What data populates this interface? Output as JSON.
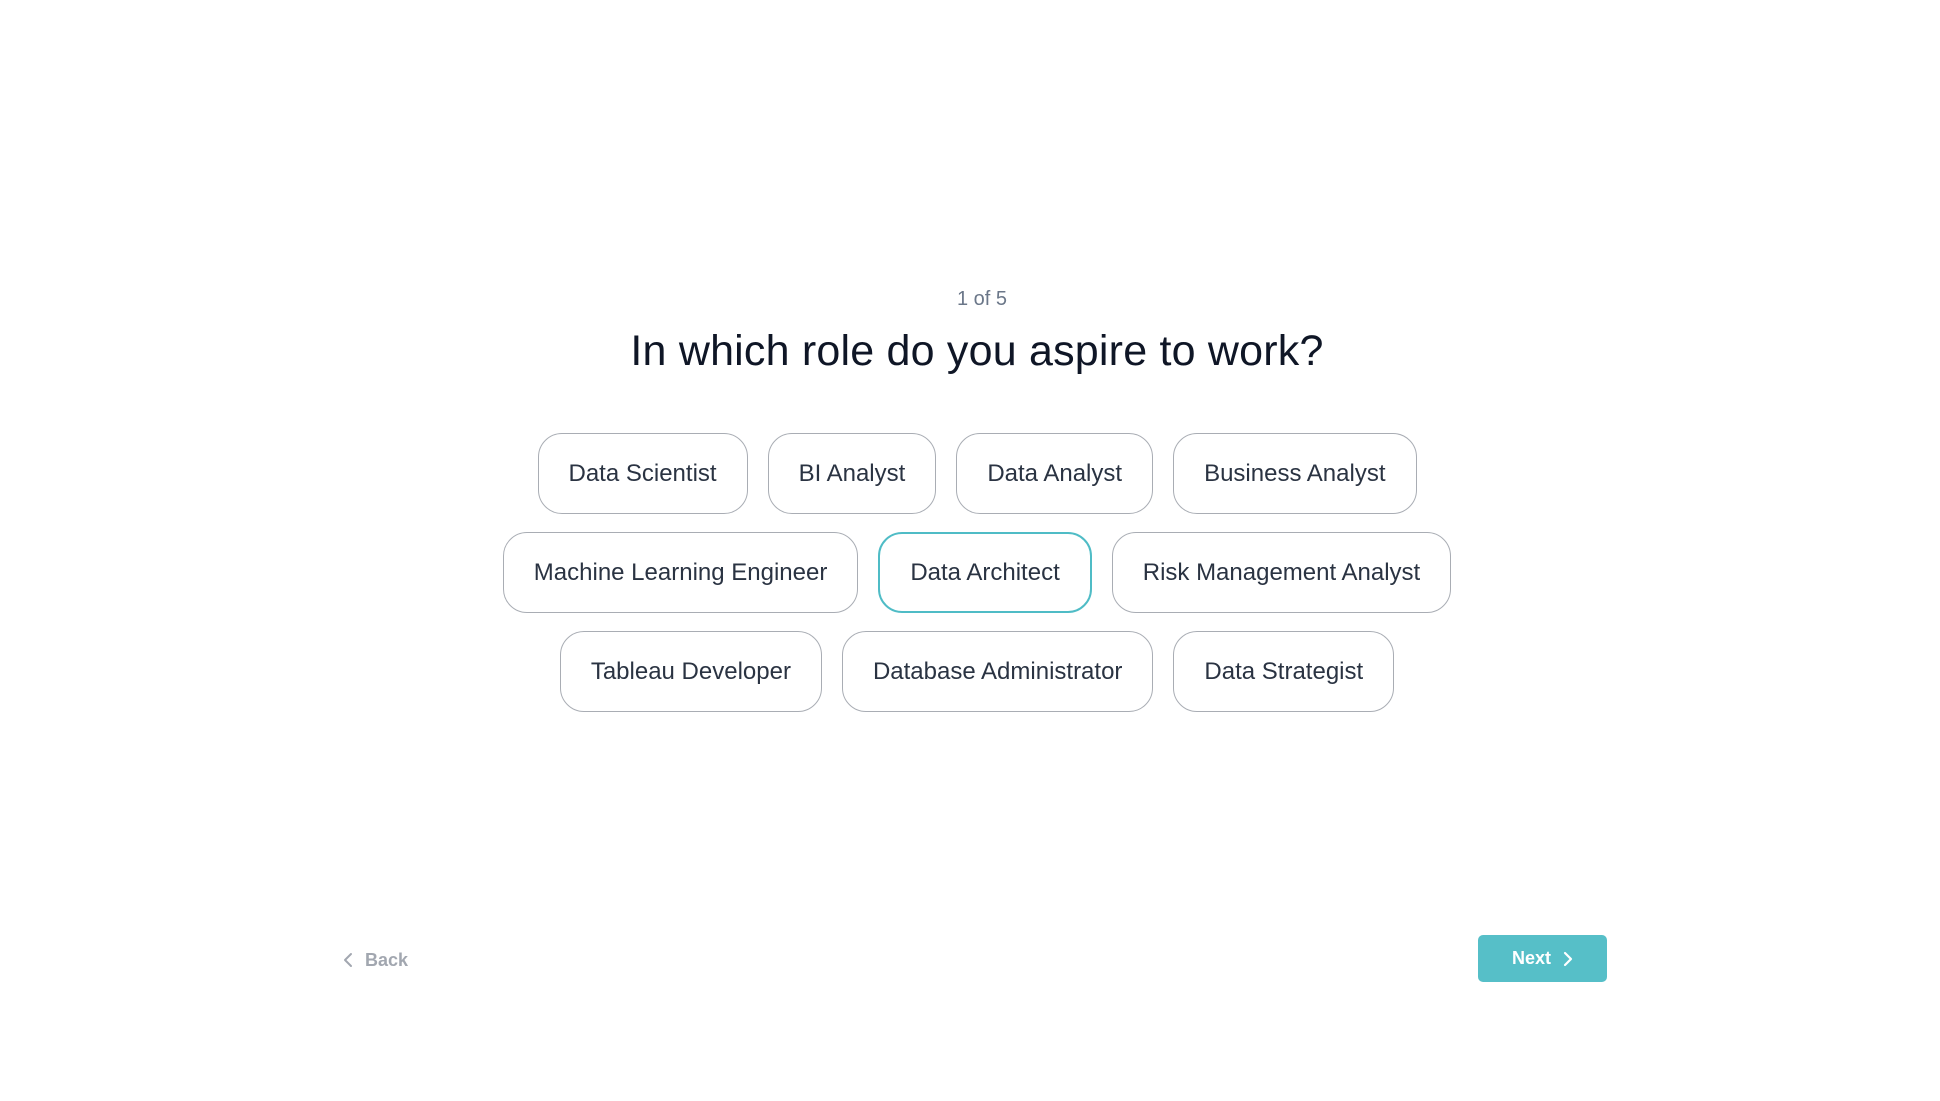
{
  "progress": {
    "label": "1 of 5",
    "current": 1,
    "total": 5
  },
  "question": "In which role do you aspire to work?",
  "options": {
    "rows": [
      [
        {
          "label": "Data Scientist",
          "selected": false
        },
        {
          "label": "BI Analyst",
          "selected": false
        },
        {
          "label": "Data Analyst",
          "selected": false
        },
        {
          "label": "Business Analyst",
          "selected": false
        }
      ],
      [
        {
          "label": "Machine Learning Engineer",
          "selected": false
        },
        {
          "label": "Data Architect",
          "selected": true
        },
        {
          "label": "Risk Management Analyst",
          "selected": false
        }
      ],
      [
        {
          "label": "Tableau Developer",
          "selected": false
        },
        {
          "label": "Database Administrator",
          "selected": false
        },
        {
          "label": "Data Strategist",
          "selected": false
        }
      ]
    ]
  },
  "nav": {
    "back_label": "Back",
    "back_icon": "chevron-left-icon",
    "next_label": "Next",
    "next_icon": "chevron-right-icon"
  },
  "colors": {
    "accent": "#56bfc8",
    "selected_border": "#4fbcc6",
    "chip_border": "#a9adb4",
    "heading": "#0f1626",
    "muted": "#6b7789"
  }
}
